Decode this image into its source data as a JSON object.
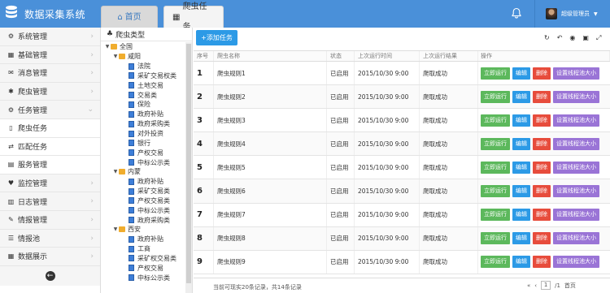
{
  "app": {
    "title": "数据采集系统"
  },
  "tabs": [
    {
      "label": "首页"
    },
    {
      "label": "爬虫任务"
    }
  ],
  "user": {
    "name": "超级管理员"
  },
  "sidebar": {
    "items": [
      {
        "label": "系统管理",
        "icon": "gears-icon",
        "sub": false
      },
      {
        "label": "基础管理",
        "icon": "table-icon",
        "sub": false
      },
      {
        "label": "消息管理",
        "icon": "envelope-icon",
        "sub": false
      },
      {
        "label": "爬虫管理",
        "icon": "bug-icon",
        "sub": false
      },
      {
        "label": "任务管理",
        "icon": "gear-icon",
        "sub": false
      },
      {
        "label": "爬虫任务",
        "icon": "document-icon",
        "sub": true
      },
      {
        "label": "匹配任务",
        "icon": "arrows-icon",
        "sub": true
      },
      {
        "label": "服务管理",
        "icon": "server-icon",
        "sub": true
      },
      {
        "label": "监控管理",
        "icon": "heartbeat-icon",
        "sub": false
      },
      {
        "label": "日志管理",
        "icon": "book-icon",
        "sub": false
      },
      {
        "label": "情报管理",
        "icon": "wrench-icon",
        "sub": false
      },
      {
        "label": "情报池",
        "icon": "list-icon",
        "sub": false
      },
      {
        "label": "数据展示",
        "icon": "table-icon",
        "sub": false
      }
    ]
  },
  "tree": {
    "title": "爬虫类型",
    "nodes": [
      {
        "label": "全国",
        "level": 0,
        "type": "folder"
      },
      {
        "label": "咸阳",
        "level": 1,
        "type": "folder"
      },
      {
        "label": "法院",
        "level": 2,
        "type": "file"
      },
      {
        "label": "采矿交易权类",
        "level": 2,
        "type": "file"
      },
      {
        "label": "土地交易",
        "level": 2,
        "type": "file"
      },
      {
        "label": "交易类",
        "level": 2,
        "type": "file"
      },
      {
        "label": "保险",
        "level": 2,
        "type": "file"
      },
      {
        "label": "政府补贴",
        "level": 2,
        "type": "file"
      },
      {
        "label": "政府采购类",
        "level": 2,
        "type": "file"
      },
      {
        "label": "对外投资",
        "level": 2,
        "type": "file"
      },
      {
        "label": "银行",
        "level": 2,
        "type": "file"
      },
      {
        "label": "产权交易",
        "level": 2,
        "type": "file"
      },
      {
        "label": "中标公示类",
        "level": 2,
        "type": "file"
      },
      {
        "label": "内蒙",
        "level": 1,
        "type": "folder"
      },
      {
        "label": "政府补贴",
        "level": 2,
        "type": "file"
      },
      {
        "label": "采矿交易类",
        "level": 2,
        "type": "file"
      },
      {
        "label": "产权交易类",
        "level": 2,
        "type": "file"
      },
      {
        "label": "中标公示类",
        "level": 2,
        "type": "file"
      },
      {
        "label": "政府采购类",
        "level": 2,
        "type": "file"
      },
      {
        "label": "西安",
        "level": 1,
        "type": "folder"
      },
      {
        "label": "政府补贴",
        "level": 2,
        "type": "file"
      },
      {
        "label": "工商",
        "level": 2,
        "type": "file"
      },
      {
        "label": "采矿权交易类",
        "level": 2,
        "type": "file"
      },
      {
        "label": "产权交易",
        "level": 2,
        "type": "file"
      },
      {
        "label": "中标公示类",
        "level": 2,
        "type": "file"
      }
    ]
  },
  "main": {
    "add_button": "+添加任务"
  },
  "table": {
    "headers": [
      "序号",
      "爬虫名称",
      "状态",
      "上次运行时间",
      "上次运行结果",
      "操作"
    ],
    "buttons": {
      "run": "立即运行",
      "edit": "编辑",
      "del": "删除",
      "cfg": "设置线程池大小"
    },
    "rows": [
      {
        "no": "1",
        "name": "爬虫规则1",
        "status": "已启用",
        "time": "2015/10/30 9:00",
        "result": "爬取成功"
      },
      {
        "no": "2",
        "name": "爬虫规则2",
        "status": "已启用",
        "time": "2015/10/30 9:00",
        "result": "爬取成功"
      },
      {
        "no": "3",
        "name": "爬虫规则3",
        "status": "已启用",
        "time": "2015/10/30 9:00",
        "result": "爬取成功"
      },
      {
        "no": "4",
        "name": "爬虫规则4",
        "status": "已启用",
        "time": "2015/10/30 9:00",
        "result": "爬取成功"
      },
      {
        "no": "5",
        "name": "爬虫规则5",
        "status": "已启用",
        "time": "2015/10/30 9:00",
        "result": "爬取成功"
      },
      {
        "no": "6",
        "name": "爬虫规则6",
        "status": "已启用",
        "time": "2015/10/30 9:00",
        "result": "爬取成功"
      },
      {
        "no": "7",
        "name": "爬虫规则7",
        "status": "已启用",
        "time": "2015/10/30 9:00",
        "result": "爬取成功"
      },
      {
        "no": "8",
        "name": "爬虫规则8",
        "status": "已启用",
        "time": "2015/10/30 9:00",
        "result": "爬取成功"
      },
      {
        "no": "9",
        "name": "爬虫规则9",
        "status": "已启用",
        "time": "2015/10/30 9:00",
        "result": "爬取成功"
      }
    ]
  },
  "footer": {
    "text": "当前可现实20条记录，共14条记录",
    "page": "1",
    "page_total": "/1",
    "first_label": "«",
    "prev_label": "‹",
    "next_label": "首页"
  }
}
